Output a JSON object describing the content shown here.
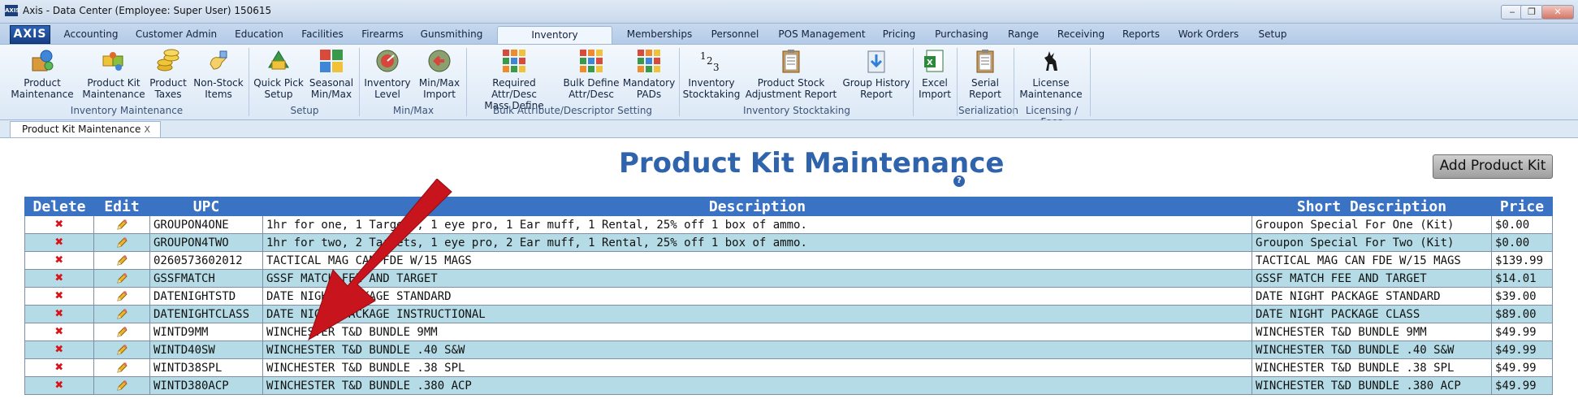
{
  "window": {
    "app_icon_label": "AXIS",
    "title": "Axis - Data Center  (Employee: Super User) 150615",
    "controls": {
      "minimize": "‒",
      "restore": "❐",
      "close": "✕"
    }
  },
  "menu": {
    "logo": "AXIS",
    "tabs": [
      {
        "label": "Accounting"
      },
      {
        "label": "Customer Admin"
      },
      {
        "label": "Education"
      },
      {
        "label": "Facilities"
      },
      {
        "label": "Firearms"
      },
      {
        "label": "Gunsmithing"
      },
      {
        "label": "Inventory Management"
      },
      {
        "label": "Memberships"
      },
      {
        "label": "Personnel"
      },
      {
        "label": "POS Management"
      },
      {
        "label": "Pricing"
      },
      {
        "label": "Purchasing"
      },
      {
        "label": "Range"
      },
      {
        "label": "Receiving"
      },
      {
        "label": "Reports"
      },
      {
        "label": "Work Orders"
      },
      {
        "label": "Setup"
      }
    ],
    "active_tab": "Inventory Management"
  },
  "ribbon": {
    "buttons": [
      {
        "line1": "Product",
        "line2": "Maintenance",
        "icon": "product-box-icon"
      },
      {
        "line1": "Product Kit",
        "line2": "Maintenance",
        "icon": "kit-puzzle-icon"
      },
      {
        "line1": "Product",
        "line2": "Taxes",
        "icon": "coins-icon"
      },
      {
        "line1": "Non-Stock",
        "line2": "Items",
        "icon": "hand-icon"
      },
      {
        "line1": "Quick Pick",
        "line2": "Setup",
        "icon": "quick-pick-icon"
      },
      {
        "line1": "Seasonal",
        "line2": "Min/Max",
        "icon": "seasonal-grid-icon"
      },
      {
        "line1": "Inventory",
        "line2": "Level",
        "icon": "gauge-icon"
      },
      {
        "line1": "Min/Max",
        "line2": "Import",
        "icon": "import-arrow-icon"
      },
      {
        "line1": "Required Attr/Desc",
        "line2": "Mass Define",
        "icon": "color-grid-icon"
      },
      {
        "line1": "Bulk Define",
        "line2": "Attr/Desc",
        "icon": "color-grid-icon"
      },
      {
        "line1": "Mandatory",
        "line2": "PADs",
        "icon": "color-grid-icon"
      },
      {
        "line1": "Inventory",
        "line2": "Stocktaking",
        "icon": "numbers-icon"
      },
      {
        "line1": "Product Stock",
        "line2": "Adjustment Report",
        "icon": "clipboard-icon"
      },
      {
        "line1": "Group History",
        "line2": "Report",
        "icon": "download-icon"
      },
      {
        "line1": "Excel",
        "line2": "Import",
        "icon": "excel-icon"
      },
      {
        "line1": "Serial",
        "line2": "Report",
        "icon": "clipboard-icon"
      },
      {
        "line1": "License",
        "line2": "Maintenance",
        "icon": "deer-icon"
      }
    ],
    "groups": [
      {
        "label": "Inventory Maintenance"
      },
      {
        "label": "Setup"
      },
      {
        "label": "Min/Max"
      },
      {
        "label": "Bulk Attribute/Descriptor Setting"
      },
      {
        "label": "Inventory Stocktaking"
      },
      {
        "label": "Serialization"
      },
      {
        "label": "Licensing / Fees"
      }
    ]
  },
  "doc_tab": {
    "label": "Product Kit Maintenance",
    "close": "X"
  },
  "page": {
    "title": "Product Kit Maintenance",
    "help": "?",
    "add_button": "Add Product Kit"
  },
  "table": {
    "headers": {
      "delete": "Delete",
      "edit": "Edit",
      "upc": "UPC",
      "description": "Description",
      "short_description": "Short Description",
      "price": "Price"
    },
    "rows": [
      {
        "upc": "GROUPON4ONE",
        "description": "1hr for one, 1 Targets, 1 eye pro, 1 Ear muff, 1 Rental, 25% off 1 box of ammo.",
        "short": "Groupon Special For One (Kit)",
        "price": "$0.00"
      },
      {
        "upc": "GROUPON4TWO",
        "description": "1hr for two, 2 Targets, 1 eye pro, 2 Ear muff, 1 Rental, 25% off 1 box of ammo.",
        "short": "Groupon Special For Two (Kit)",
        "price": "$0.00"
      },
      {
        "upc": "0260573602012",
        "description": "TACTICAL MAG CAN FDE W/15 MAGS",
        "short": "TACTICAL MAG CAN FDE W/15 MAGS",
        "price": "$139.99"
      },
      {
        "upc": "GSSFMATCH",
        "description": "GSSF MATCH FEE AND TARGET",
        "short": "GSSF MATCH FEE AND TARGET",
        "price": "$14.01"
      },
      {
        "upc": "DATENIGHTSTD",
        "description": "DATE NIGHT PACKAGE STANDARD",
        "short": "DATE NIGHT PACKAGE STANDARD",
        "price": "$39.00"
      },
      {
        "upc": "DATENIGHTCLASS",
        "description": "DATE NIGHT PACKAGE INSTRUCTIONAL",
        "short": "DATE NIGHT PACKAGE CLASS",
        "price": "$89.00"
      },
      {
        "upc": "WINTD9MM",
        "description": "WINCHESTER T&D BUNDLE 9MM",
        "short": "WINCHESTER T&D BUNDLE 9MM",
        "price": "$49.99"
      },
      {
        "upc": "WINTD40SW",
        "description": "WINCHESTER T&D BUNDLE .40 S&W",
        "short": "WINCHESTER T&D BUNDLE .40 S&W",
        "price": "$49.99"
      },
      {
        "upc": "WINTD38SPL",
        "description": "WINCHESTER T&D BUNDLE .38 SPL",
        "short": "WINCHESTER T&D BUNDLE .38 SPL",
        "price": "$49.99"
      },
      {
        "upc": "WINTD380ACP",
        "description": "WINCHESTER T&D BUNDLE .380 ACP",
        "short": "WINCHESTER T&D BUNDLE .380 ACP",
        "price": "$49.99"
      }
    ],
    "delete_glyph": "✖"
  },
  "colors": {
    "header_blue": "#3a72c4",
    "row_alt": "#b4dbe6",
    "title_blue": "#2f63ac",
    "arrow_red": "#c8151d"
  }
}
